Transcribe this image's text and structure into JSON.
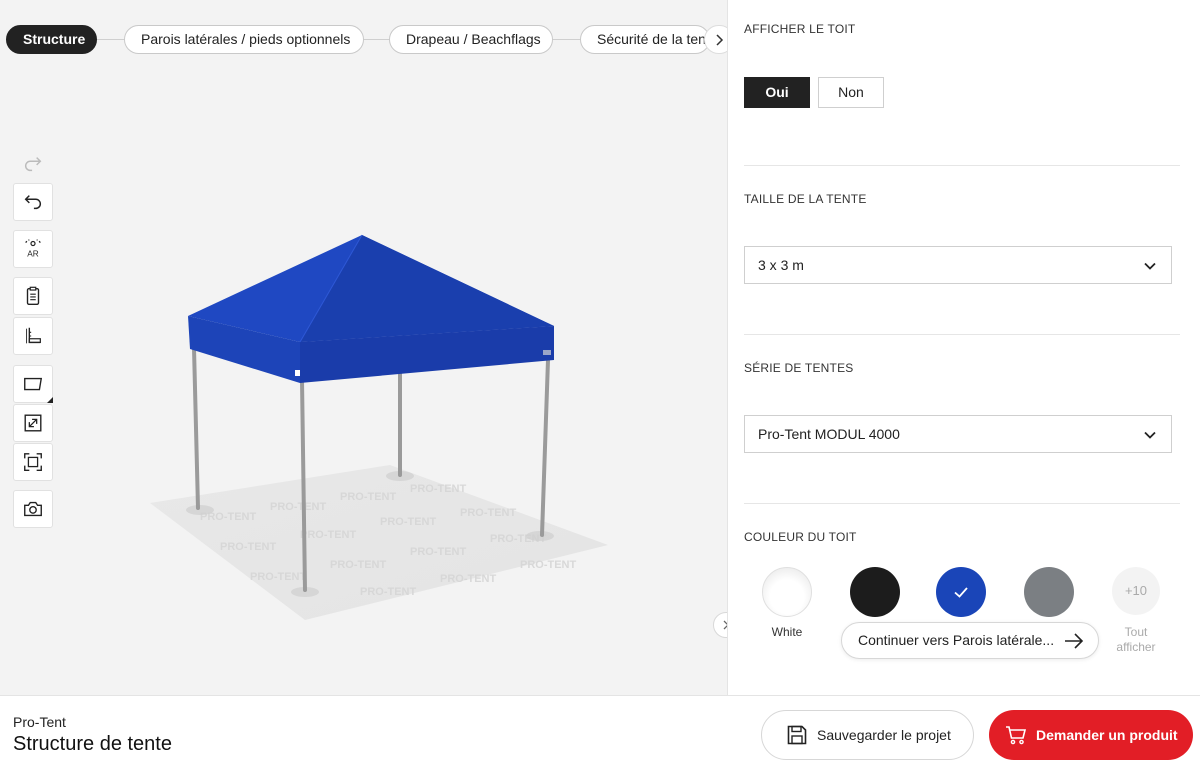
{
  "steps": [
    {
      "label": "Structure",
      "active": true
    },
    {
      "label": "Parois latérales / pieds optionnels",
      "active": false
    },
    {
      "label": "Drapeau / Beachflags",
      "active": false
    },
    {
      "label": "Sécurité de la tente",
      "active": false
    }
  ],
  "toolbar": {
    "redo_icon": "redo-icon",
    "undo_icon": "undo-icon",
    "ar_label": "AR",
    "icons": [
      "clipboard-icon",
      "measure-icon",
      "background-icon",
      "expand-icon",
      "fit-icon",
      "camera-icon"
    ]
  },
  "scene": {
    "floor_text": "PRO-TENT",
    "canopy_color": "#1b3fb5"
  },
  "panel": {
    "roof_section": {
      "title": "AFFICHER LE TOIT",
      "yes_label": "Oui",
      "no_label": "Non",
      "selected": "Oui"
    },
    "size_section": {
      "title": "TAILLE DE LA TENTE",
      "value": "3 x 3 m"
    },
    "series_section": {
      "title": "SÉRIE DE TENTES",
      "value": "Pro-Tent MODUL 4000"
    },
    "color_section": {
      "title": "COULEUR DU TOIT",
      "swatches": [
        {
          "label": "White",
          "color": "#ffffff"
        },
        {
          "label": "",
          "color": "#1c1c1c"
        },
        {
          "label": "",
          "color": "#1a45b8",
          "selected": true
        },
        {
          "label": "",
          "color": "#7b7f83"
        }
      ],
      "more_count": "+10",
      "more_label": "Tout afficher"
    },
    "continue_label": "Continuer vers Parois latérale..."
  },
  "bottom": {
    "brand": "Pro-Tent",
    "product_title": "Structure de tente",
    "save_label": "Sauvegarder le projet",
    "request_label": "Demander un produit"
  },
  "colors": {
    "accent_red": "#e21e26",
    "active_dark": "#222222"
  }
}
